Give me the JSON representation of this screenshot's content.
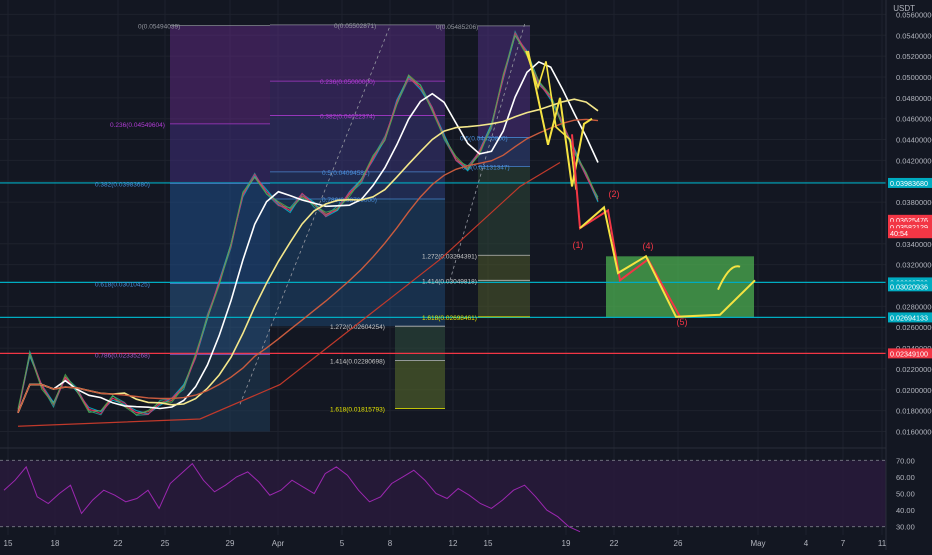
{
  "header": {
    "quote_currency": "USDT"
  },
  "chart_data": {
    "type": "line",
    "x_ticks": [
      "15",
      "18",
      "22",
      "25",
      "29",
      "Apr",
      "5",
      "8",
      "12",
      "15",
      "19",
      "22",
      "26",
      "May",
      "4",
      "7",
      "11"
    ],
    "y_ticks": [
      "0.05600000",
      "0.05400000",
      "0.05200000",
      "0.05000000",
      "0.04800000",
      "0.04600000",
      "0.04400000",
      "0.04200000",
      "0.04000000",
      "0.03800000",
      "0.03400000",
      "0.03200000",
      "0.02800000",
      "0.02600000",
      "0.02400000",
      "0.02200000",
      "0.02000000",
      "0.01800000",
      "0.01600000"
    ],
    "y_range": [
      0.0148,
      0.057
    ],
    "price_badges": [
      {
        "label": "0.03983680",
        "color": "#00acc1"
      },
      {
        "label": "0.03625476",
        "color": "#f23645"
      },
      {
        "label": "0.03582129",
        "color": "#f23645"
      },
      {
        "label": "40:54",
        "color": "#f23645"
      },
      {
        "label": "0.03029789",
        "color": "#00acc1"
      },
      {
        "label": "0.03020936",
        "color": "#00acc1"
      },
      {
        "label": "0.02694133",
        "color": "#00acc1"
      },
      {
        "label": "0.02349100",
        "color": "#f23645"
      }
    ],
    "horizontal_lines": [
      {
        "value": 0.0398368,
        "color": "#00acc1"
      },
      {
        "value": 0.0302979,
        "color": "#00acc1"
      },
      {
        "value": 0.0269413,
        "color": "#00acc1"
      },
      {
        "value": 0.023491,
        "color": "#f23645"
      }
    ],
    "fib_labels": [
      {
        "text": "0(0.05494039)",
        "value": 0.0549404,
        "color": "#9598a1"
      },
      {
        "text": "0.236(0.04549604)",
        "value": 0.0455,
        "color": "#b23cd6"
      },
      {
        "text": "0.382(0.03983680)",
        "value": 0.0398,
        "color": "#4b8ed9"
      },
      {
        "text": "0.618(0.03010425)",
        "value": 0.0302,
        "color": "#4b8ed9"
      },
      {
        "text": "0.786(0.02335268)",
        "value": 0.0234,
        "color": "#9c5fd0"
      },
      {
        "text": "0(0.05502871)",
        "value": 0.055,
        "color": "#9598a1"
      },
      {
        "text": "0.236(0.05000000)",
        "value": 0.0496,
        "color": "#b23cd6"
      },
      {
        "text": "0.382(0.04622374)",
        "value": 0.0463,
        "color": "#b23cd6"
      },
      {
        "text": "0.5(0.04094581)",
        "value": 0.0409,
        "color": "#4b8ed9"
      },
      {
        "text": "0.786(0.03700000)",
        "value": 0.0383,
        "color": "#4b8ed9"
      },
      {
        "text": "1.272(0.02604254)",
        "value": 0.0261,
        "color": "#c9c9c9"
      },
      {
        "text": "1.414(0.02280698)",
        "value": 0.0228,
        "color": "#c9c9c9"
      },
      {
        "text": "1.618(0.01815793)",
        "value": 0.0182,
        "color": "#e6e600"
      },
      {
        "text": "0(0.05485206)",
        "value": 0.0549,
        "color": "#9598a1"
      },
      {
        "text": "0.5(0.04420800)",
        "value": 0.0442,
        "color": "#4b8ed9"
      },
      {
        "text": "0.6(0.04131347)",
        "value": 0.0414,
        "color": "#4b8ed9"
      },
      {
        "text": "1.272(0.03294391)",
        "value": 0.0329,
        "color": "#c9c9c9"
      },
      {
        "text": "1.414(0.03049818)",
        "value": 0.0305,
        "color": "#c9c9c9"
      },
      {
        "text": "1.618(0.02698461)",
        "value": 0.027,
        "color": "#e6e600"
      }
    ],
    "wave_labels": [
      {
        "text": "(1)",
        "color": "#f23645"
      },
      {
        "text": "(2)",
        "color": "#f23645"
      },
      {
        "text": "(4)",
        "color": "#f23645"
      },
      {
        "text": "(5)",
        "color": "#f23645"
      }
    ],
    "target_zone": {
      "top": 0.0328,
      "bottom": 0.0269,
      "color": "#4caf50"
    },
    "rsi": {
      "y_ticks": [
        "70.00",
        "60.00",
        "50.00",
        "40.00",
        "30.00"
      ],
      "upper": 70,
      "lower": 30,
      "values": [
        52,
        58,
        66,
        48,
        44,
        50,
        55,
        38,
        46,
        52,
        49,
        45,
        47,
        52,
        41,
        56,
        62,
        68,
        58,
        51,
        55,
        60,
        63,
        57,
        49,
        52,
        58,
        54,
        50,
        62,
        66,
        61,
        52,
        45,
        48,
        56,
        60,
        64,
        58,
        50,
        47,
        53,
        49,
        44,
        41,
        46,
        52,
        55,
        48,
        40,
        36,
        30,
        27
      ]
    },
    "price_series": [
      0.0178,
      0.0232,
      0.0205,
      0.0188,
      0.021,
      0.0198,
      0.0183,
      0.0179,
      0.019,
      0.0186,
      0.018,
      0.0177,
      0.0185,
      0.0192,
      0.0205,
      0.023,
      0.0268,
      0.0305,
      0.034,
      0.0385,
      0.0405,
      0.0392,
      0.0378,
      0.037,
      0.0388,
      0.038,
      0.0366,
      0.0372,
      0.039,
      0.0402,
      0.042,
      0.044,
      0.0478,
      0.05,
      0.0488,
      0.047,
      0.0445,
      0.042,
      0.041,
      0.043,
      0.0455,
      0.0498,
      0.054,
      0.0525,
      0.0495,
      0.0478,
      0.0455,
      0.0432,
      0.0405,
      0.038
    ]
  }
}
